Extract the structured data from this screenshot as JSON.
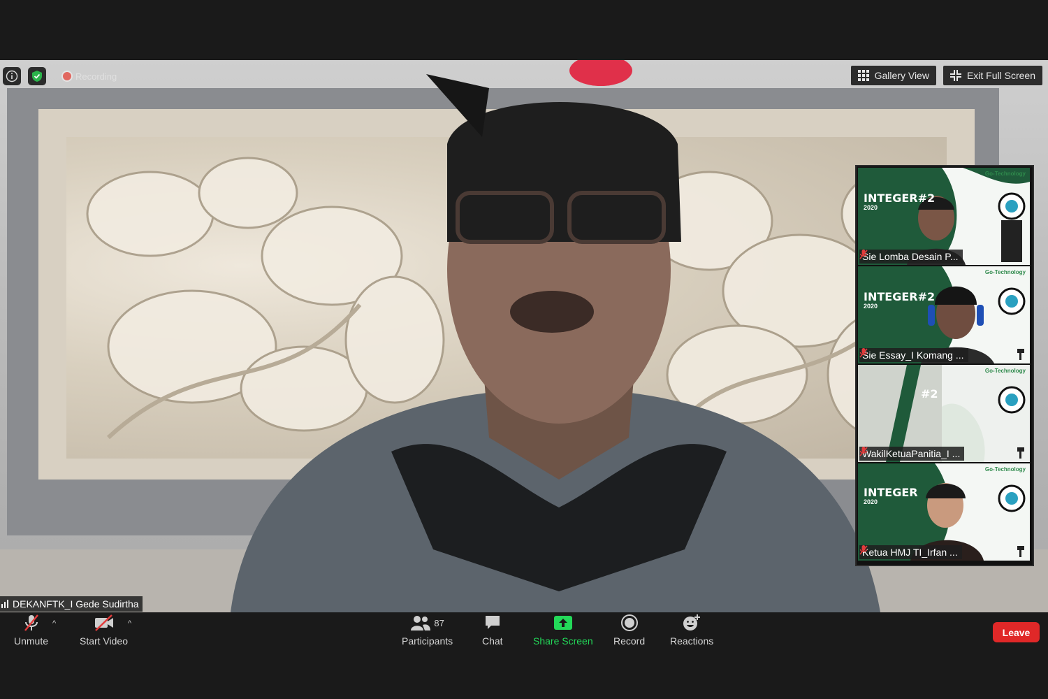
{
  "meeting": {
    "recording_label": "Recording",
    "view_button": "Gallery View",
    "exit_fullscreen_button": "Exit Full Screen"
  },
  "speaker": {
    "name": "DEKANFTK_I Gede Sudirtha"
  },
  "gallery": {
    "tiles": [
      {
        "name": "Sie Lomba Desain P...",
        "banner": "INTEGER#2",
        "year": "2020",
        "brand": "Go-Technology"
      },
      {
        "name": "Sie Essay_I Komang ...",
        "banner": "INTEGER#2",
        "year": "2020",
        "brand": "Go-Technology"
      },
      {
        "name": "WakilKetuaPanitia_I ...",
        "banner": "#2",
        "year": "",
        "brand": "Go-Technology"
      },
      {
        "name": "Ketua HMJ TI_Irfan ...",
        "banner": "INTEGER",
        "year": "2020",
        "brand": "Go-Technology"
      }
    ]
  },
  "toolbar": {
    "unmute": "Unmute",
    "start_video": "Start Video",
    "participants": "Participants",
    "participants_count": "87",
    "chat": "Chat",
    "share_screen": "Share Screen",
    "record": "Record",
    "reactions": "Reactions",
    "leave": "Leave",
    "share_color": "#23d959",
    "leave_color": "#e02828"
  }
}
